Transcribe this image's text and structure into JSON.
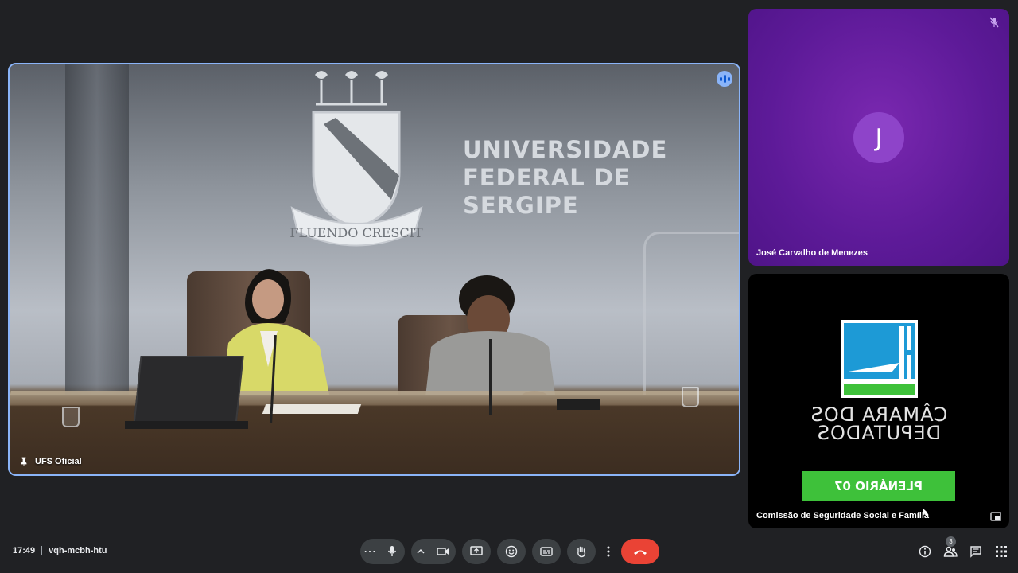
{
  "meeting": {
    "time": "17:49",
    "code": "vqh-mcbh-htu"
  },
  "main_tile": {
    "participant_name": "UFS Oficial",
    "wall_text": [
      "UNIVERSIDADE",
      "FEDERAL DE",
      "SERGIPE"
    ],
    "crest_motto": "FLUENDO CRESCIT"
  },
  "side_tiles": [
    {
      "participant_name": "José Carvalho de Menezes",
      "avatar_letter": "J",
      "avatar_color": "#8e44c9",
      "background": "#5d1a98",
      "muted": true
    },
    {
      "participant_name": "Comissão de Seguridade Social e Família",
      "logo_text": [
        "CÂMARA DOS",
        "DEPUTADOS"
      ],
      "banner_text": "PLENÁRIO 07"
    }
  ],
  "controls": {
    "more_options_label": "⋯",
    "end_call_color": "#ea4335"
  },
  "right_icons": {
    "people_count": "3"
  },
  "colors": {
    "accent": "#8ab4f8",
    "bar_bg": "#202124",
    "button_bg": "#3c4043",
    "banner_green": "#3ec13a"
  }
}
